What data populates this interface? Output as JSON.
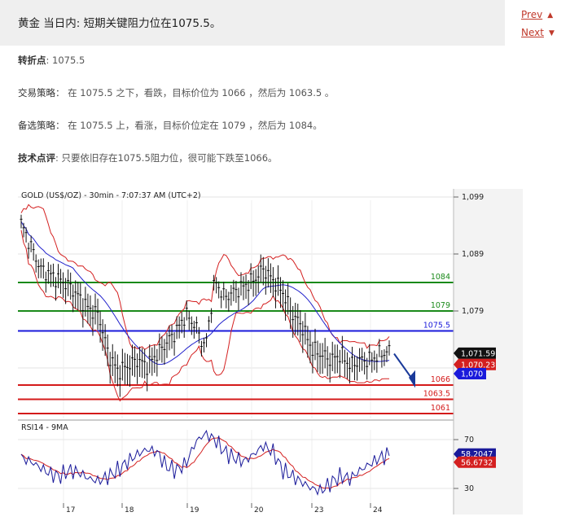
{
  "header": {
    "title": "黄金 当日内: 短期关键阻力位在1075.5。"
  },
  "nav": {
    "prev": "Prev",
    "next": "Next"
  },
  "analysis": {
    "pivot_label": "转折点",
    "pivot_value": ": 1075.5",
    "strategy_label": "交易策略",
    "strategy_text": "：  在 1075.5 之下，看跌，目标价位为 1066 ，然后为 1063.5 。",
    "alt_label": "备选策略",
    "alt_text": "：  在 1075.5 上，看涨，目标价位定在 1079 ，然后为 1084。",
    "comment_label": "技术点评",
    "comment_text": ": 只要依旧存在1075.5阻力位，很可能下跌至1066。"
  },
  "chart": {
    "title": "GOLD (US$/OZ) - 30min - 7:07:37 AM (UTC+2)",
    "price_axis_ticks": [
      "1,099",
      "1,089",
      "1,079"
    ],
    "price_tag_main": "1,071.59",
    "price_tag_red": "1,070.23",
    "price_tag_blue": "1,070",
    "levels": [
      {
        "label": "1084",
        "value": 1084,
        "color": "#1a8a1a"
      },
      {
        "label": "1079",
        "value": 1079,
        "color": "#1a8a1a"
      },
      {
        "label": "1075.5",
        "value": 1075.5,
        "color": "#1a1adb"
      },
      {
        "label": "1066",
        "value": 1066,
        "color": "#d41a1a"
      },
      {
        "label": "1063.5",
        "value": 1063.5,
        "color": "#d41a1a"
      },
      {
        "label": "1061",
        "value": 1061,
        "color": "#d41a1a"
      }
    ],
    "dates": [
      "17",
      "18",
      "19",
      "20",
      "23",
      "24"
    ],
    "rsi_title": "RSI14 - 9MA",
    "rsi_ticks": [
      "70",
      "30"
    ],
    "rsi_tag_blue": "58.2047",
    "rsi_tag_red": "56.6732"
  },
  "chart_data": {
    "type": "line",
    "title": "GOLD (US$/OZ) - 30min - 7:07:37 AM (UTC+2)",
    "x": [
      "17",
      "18",
      "19",
      "20",
      "23",
      "24"
    ],
    "series": [],
    "ylim": [
      1060,
      1100
    ],
    "price_close_path": [
      1094,
      1090,
      1086,
      1085,
      1084,
      1083,
      1081,
      1079,
      1078,
      1071,
      1068,
      1069,
      1070,
      1069,
      1071,
      1073,
      1075,
      1078,
      1076,
      1072,
      1084,
      1081,
      1082,
      1083,
      1084,
      1086,
      1084,
      1082,
      1078,
      1076,
      1072,
      1071,
      1070,
      1071,
      1069,
      1070,
      1070,
      1071,
      1071.59
    ],
    "rsi_path": [
      55,
      52,
      47,
      42,
      40,
      45,
      43,
      38,
      36,
      40,
      45,
      52,
      58,
      62,
      60,
      48,
      45,
      50,
      68,
      75,
      70,
      60,
      55,
      52,
      58,
      65,
      60,
      45,
      40,
      35,
      30,
      28,
      35,
      40,
      38,
      45,
      50,
      55,
      58.2
    ],
    "levels": [
      1084,
      1079,
      1075.5,
      1066,
      1063.5,
      1061
    ]
  }
}
